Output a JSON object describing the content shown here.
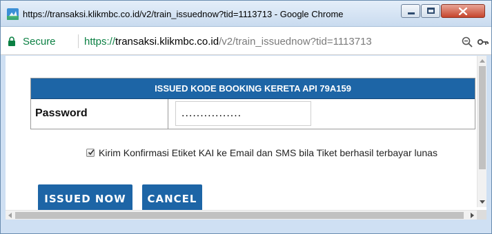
{
  "window": {
    "title": "https://transaksi.klikmbc.co.id/v2/train_issuednow?tid=1113713 - Google Chrome",
    "icon": "chrome-app-icon"
  },
  "address_bar": {
    "secure_label": "Secure",
    "url_protocol": "https://",
    "url_host": "transaksi.klikmbc.co.id",
    "url_path": "/v2/train_issuednow?tid=1113713",
    "icons": [
      "lock-icon",
      "zoom-icon",
      "key-icon"
    ]
  },
  "form": {
    "header": "ISSUED KODE BOOKING KERETA API 79A159",
    "password_label": "Password",
    "password_value": "................",
    "confirm_checked": true,
    "confirm_label": "Kirim Konfirmasi Etiket KAI ke Email dan SMS bila Tiket berhasil terbayar lunas",
    "issue_button": "ISSUED NOW",
    "cancel_button": "CANCEL"
  },
  "colors": {
    "primary": "#1d65a6",
    "secure_green": "#0b8043"
  }
}
